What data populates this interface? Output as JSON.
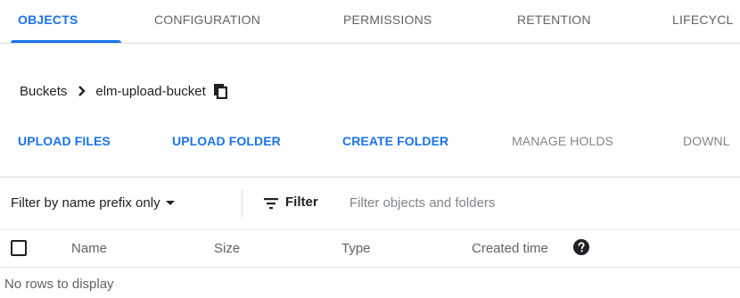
{
  "tabs": [
    {
      "label": "OBJECTS",
      "active": true
    },
    {
      "label": "CONFIGURATION",
      "active": false
    },
    {
      "label": "PERMISSIONS",
      "active": false
    },
    {
      "label": "RETENTION",
      "active": false
    },
    {
      "label": "LIFECYCL",
      "active": false
    }
  ],
  "breadcrumb": {
    "parent": "Buckets",
    "current": "elm-upload-bucket",
    "separator_icon": "chevron-right-icon",
    "copy_icon": "copy-icon"
  },
  "actions": [
    {
      "label": "UPLOAD FILES",
      "enabled": true
    },
    {
      "label": "UPLOAD FOLDER",
      "enabled": true
    },
    {
      "label": "CREATE FOLDER",
      "enabled": true
    },
    {
      "label": "MANAGE HOLDS",
      "enabled": false
    },
    {
      "label": "DOWNL",
      "enabled": false
    }
  ],
  "filter": {
    "mode_selected": "Filter by name prefix only",
    "label": "Filter",
    "placeholder": "Filter objects and folders",
    "icon": "filter-lines-icon"
  },
  "table": {
    "columns": [
      "Name",
      "Size",
      "Type",
      "Created time"
    ],
    "help_icon": "help-circle-icon",
    "empty_message": "No rows to display"
  },
  "colors": {
    "accent": "#1a73e8",
    "disabled": "#80868b",
    "text": "#202124",
    "divider": "#dadce0"
  }
}
